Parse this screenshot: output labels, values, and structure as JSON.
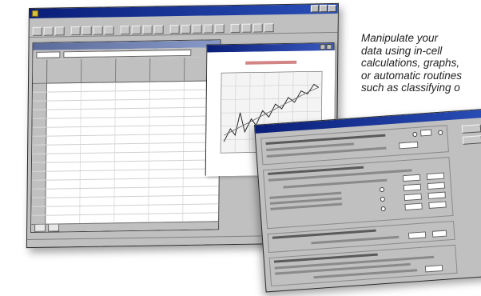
{
  "caption": {
    "lines": [
      "Manipulate your",
      "data using in-cell",
      "calculations, graphs,",
      "or automatic routines",
      "such as classifying o"
    ]
  },
  "app": {
    "window_title": "",
    "menu": [
      "",
      "",
      "",
      "",
      "",
      "",
      "",
      "",
      "",
      ""
    ],
    "status_text": "",
    "sheet": {
      "columns": [
        "",
        "",
        "",
        ""
      ],
      "rows": [
        [
          "",
          "",
          "",
          ""
        ],
        [
          "",
          "",
          "",
          ""
        ],
        [
          "",
          "",
          "",
          ""
        ],
        [
          "",
          "",
          "",
          ""
        ],
        [
          "",
          "",
          "",
          ""
        ],
        [
          "",
          "",
          "",
          ""
        ],
        [
          "",
          "",
          "",
          ""
        ],
        [
          "",
          "",
          "",
          ""
        ],
        [
          "",
          "",
          "",
          ""
        ],
        [
          "",
          "",
          "",
          ""
        ],
        [
          "",
          "",
          "",
          ""
        ],
        [
          "",
          "",
          "",
          ""
        ],
        [
          "",
          "",
          "",
          ""
        ],
        [
          "",
          "",
          "",
          ""
        ],
        [
          "",
          "",
          "",
          ""
        ],
        [
          "",
          "",
          "",
          ""
        ]
      ]
    },
    "graph_title": "",
    "dialog_title": ""
  },
  "colors": {
    "titlebar": "#0a1e78",
    "window_face": "#c0c0c0",
    "graph_series_a": "#333333",
    "graph_series_b": "#555555"
  }
}
